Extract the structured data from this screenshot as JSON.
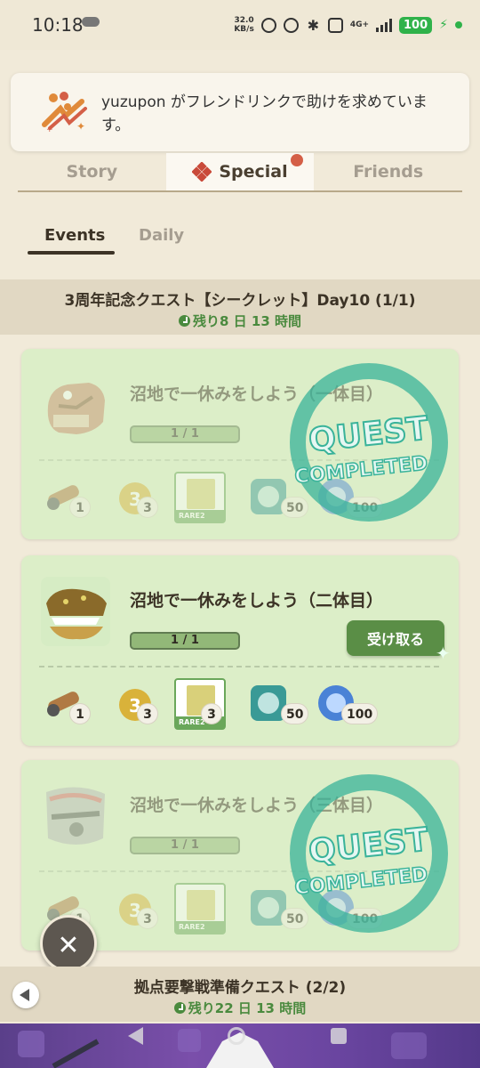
{
  "status_bar": {
    "time": "10:18",
    "net_speed_top": "32.0",
    "net_speed_bottom": "KB/s",
    "network": "4G+",
    "battery": "100"
  },
  "notification": {
    "text": "yuzupon がフレンドリンクで助けを求めています。"
  },
  "tabs": [
    {
      "label": "Story"
    },
    {
      "label": "Special"
    },
    {
      "label": "Friends"
    }
  ],
  "subtabs": [
    {
      "label": "Events"
    },
    {
      "label": "Daily"
    }
  ],
  "sections": [
    {
      "title": "3周年記念クエスト【シークレット】Day10 (1/1)",
      "time": "残り8 日 13 時間"
    },
    {
      "title": "拠点要撃戦準備クエスト (2/2)",
      "time": "残り22 日 13 時間"
    }
  ],
  "quests": [
    {
      "title": "沼地で一休みをしよう（一体目）",
      "progress": "1 / 1",
      "completed": true,
      "rewards": [
        "1",
        "3",
        "RARE2",
        "50",
        "100"
      ]
    },
    {
      "title": "沼地で一休みをしよう（二体目）",
      "progress": "1 / 1",
      "completed": false,
      "claim_label": "受け取る",
      "rewards": [
        "1",
        "3",
        "3",
        "50",
        "100"
      ],
      "rare_label": "RARE2"
    },
    {
      "title": "沼地で一休みをしよう（三体目）",
      "progress": "1 / 1",
      "completed": true,
      "rewards": [
        "1",
        "3",
        "RARE2",
        "50",
        "100"
      ]
    }
  ],
  "stamp": {
    "line1": "QUEST",
    "line2": "COMPLETED"
  },
  "colors": {
    "background": "#f1ead9",
    "card": "#dceec8",
    "accent_green": "#5a8e46",
    "badge_red": "#d45f47",
    "stamp_teal": "#3ab39a"
  }
}
